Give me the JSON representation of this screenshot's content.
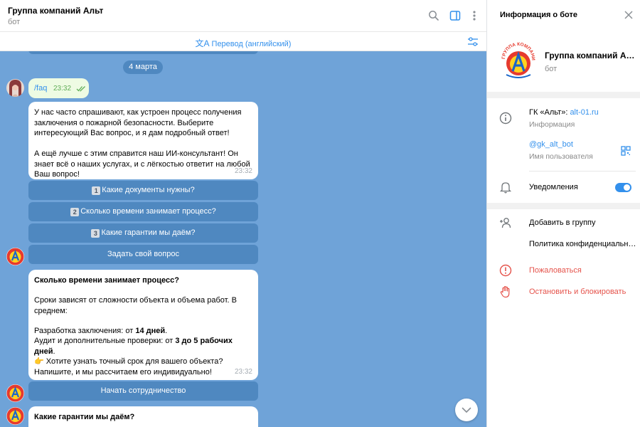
{
  "chat": {
    "title": "Группа компаний Альт",
    "subtitle": "бот",
    "translate_label": "Перевод (английский)",
    "date_label": "4 марта"
  },
  "messages": {
    "outgoing": {
      "text": "/faq",
      "time": "23:32"
    },
    "intro": {
      "text": "У нас часто спрашивают, как устроен процесс получения заключения о пожарной безопасности. Выберите интересующий Вас вопрос, и я дам подробный ответ!\n\nА ещё лучше с этим справится наш ИИ-консультант! Он знает всё о наших услугах, и с лёгкостью ответит на любой Ваш вопрос!",
      "time": "23:32"
    },
    "time_answer": {
      "title": "Сколько времени занимает процесс?",
      "p1": "Сроки зависят от сложности объекта и объема работ. В среднем:",
      "line1_prefix": "Разработка заключения: от ",
      "line1_bold": "14 дней",
      "line1_suffix": ".",
      "line2_prefix": "Аудит и дополнительные проверки: от ",
      "line2_bold": "3 до 5 рабочих дней",
      "line2_suffix": ".",
      "cta_emoji": "👉",
      "cta": " Хотите узнать точный срок для вашего объекта? Напишите, и мы рассчитаем его индивидуально!",
      "time": "23:32"
    },
    "guarantees_title": "Какие гарантии мы даём?"
  },
  "keyboard": {
    "q1_num": "1",
    "q1": "Какие документы нужны?",
    "q2_num": "2",
    "q2": "Сколько времени занимает процесс?",
    "q3_num": "3",
    "q3": "Какие гарантии мы даём?",
    "ask": "Задать свой вопрос",
    "start": "Начать сотрудничество"
  },
  "info_panel": {
    "header": "Информация о боте",
    "name": "Группа компаний Альт",
    "name_sub": "бот",
    "about_prefix": "ГК «Альт»: ",
    "about_link": "alt-01.ru",
    "about_label": "Информация",
    "username": "@gk_alt_bot",
    "username_label": "Имя пользователя",
    "notifications": "Уведомления",
    "notifications_on": true,
    "add_to_group": "Добавить в группу",
    "privacy": "Политика конфиденциальности",
    "report": "Пожаловаться",
    "stop_block": "Остановить и блокировать"
  },
  "colors": {
    "accent": "#3390ec",
    "chat_bg": "#6fa3d8",
    "keyboard_btn": "#4f88c0",
    "danger": "#e5534b"
  },
  "logo_text": "ГРУППА КОМПАНИЙ"
}
